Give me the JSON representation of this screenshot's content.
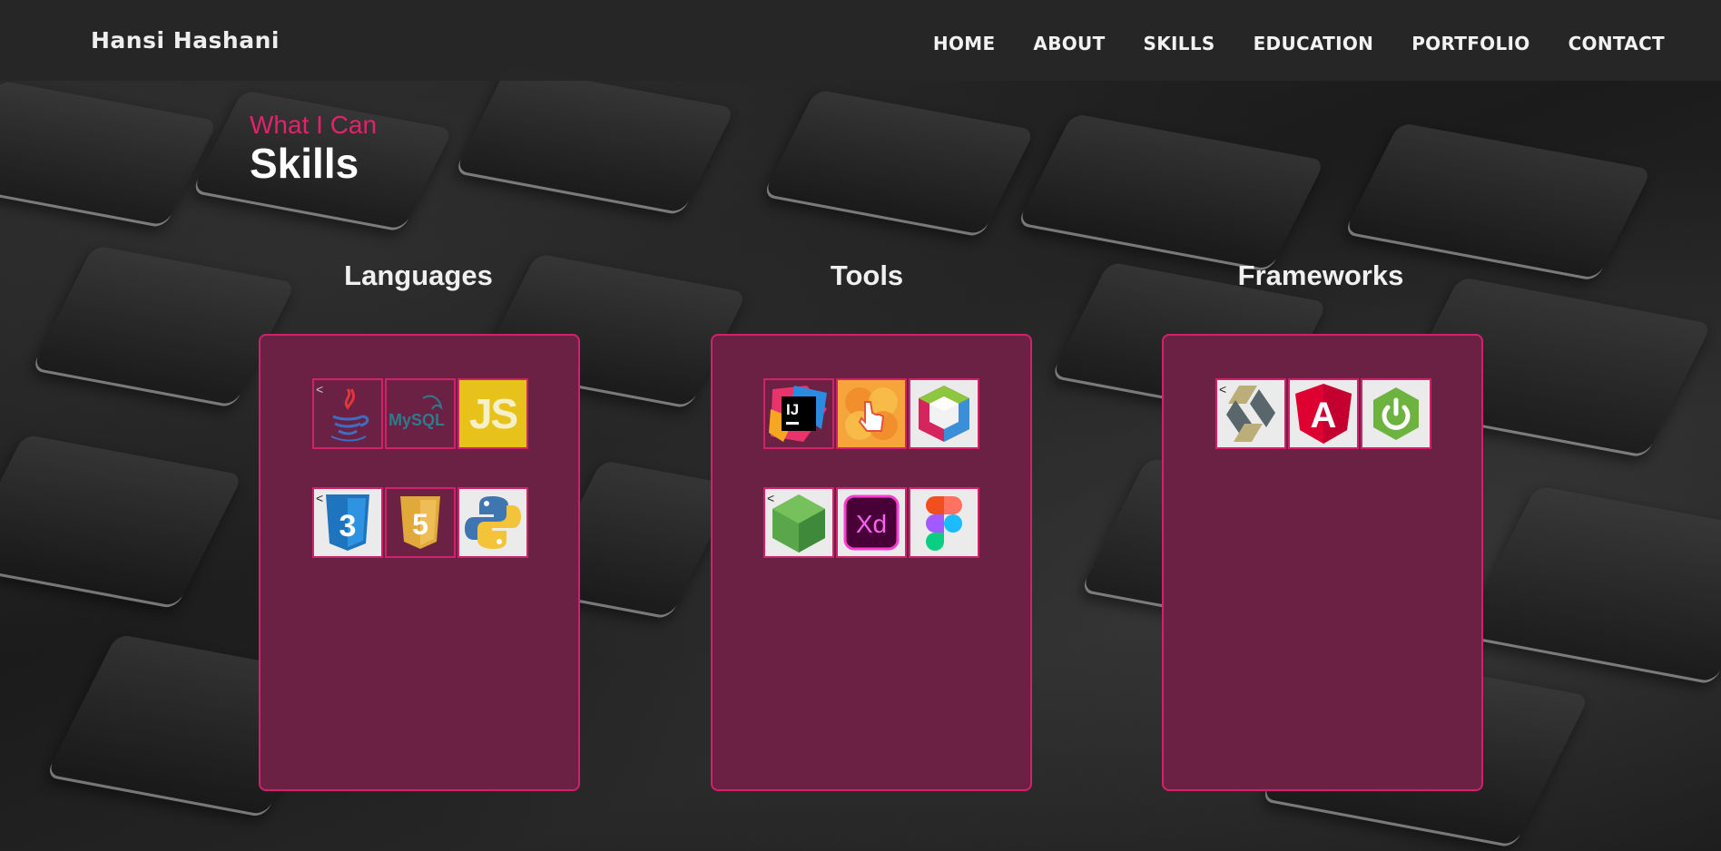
{
  "brand": "Hansi Hashani",
  "nav": [
    "HOME",
    "ABOUT",
    "SKILLS",
    "EDUCATION",
    "PORTFOLIO",
    "CONTACT"
  ],
  "section": {
    "subtitle": "What I Can",
    "title": "Skills"
  },
  "columns": [
    {
      "title": "Languages",
      "icons": [
        "java-icon",
        "mysql-icon",
        "javascript-icon",
        "css3-icon",
        "html5-icon",
        "python-icon"
      ]
    },
    {
      "title": "Tools",
      "icons": [
        "intellij-idea-icon",
        "balsamiq-hand-icon",
        "netbeans-icon",
        "nodejs-icon",
        "adobe-xd-icon",
        "figma-icon"
      ]
    },
    {
      "title": "Frameworks",
      "icons": [
        "hibernate-icon",
        "angular-icon",
        "spring-boot-icon"
      ]
    }
  ],
  "icon_text": {
    "intellij": "IJ",
    "mysql": "MySQL",
    "js": "JS",
    "xd": "Xd",
    "css": "3",
    "html": "5",
    "angular": "A",
    "broken_marker": "<"
  },
  "colors": {
    "accent": "#e3226b",
    "card_bg": "#6b2143",
    "card_border": "#d1216a",
    "navbar_bg": "#262626"
  }
}
